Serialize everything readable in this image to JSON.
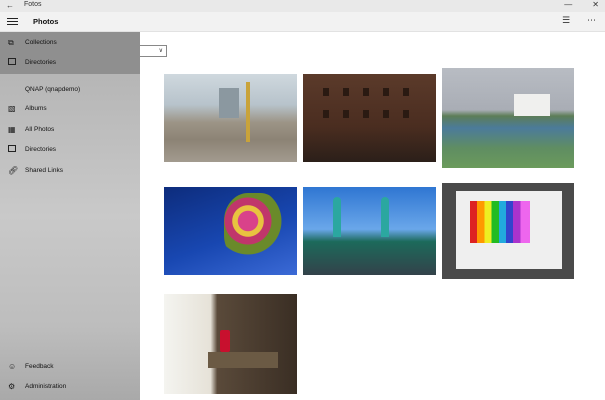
{
  "window": {
    "app_title": "Fotos",
    "back_glyph": "←",
    "minimize_glyph": "—",
    "close_glyph": "✕"
  },
  "header": {
    "title": "Photos",
    "menu_icon": "hamburger-icon",
    "select_icon": "select-list-icon",
    "more_icon": "more-icon"
  },
  "content": {
    "dropdown_glyph": "∨"
  },
  "sidebar": {
    "top_items": [
      {
        "label": "Collections",
        "icon": "collections-icon"
      },
      {
        "label": "Directories",
        "icon": "directories-icon"
      }
    ],
    "section_header": "QNAP (qnapdemo)",
    "section_items": [
      {
        "label": "Albums",
        "icon": "albums-icon"
      },
      {
        "label": "All Photos",
        "icon": "all-photos-icon"
      },
      {
        "label": "Directories",
        "icon": "directories-icon"
      },
      {
        "label": "Shared Links",
        "icon": "shared-links-icon"
      }
    ],
    "bottom_items": [
      {
        "label": "Feedback",
        "icon": "feedback-icon"
      },
      {
        "label": "Administration",
        "icon": "gear-icon"
      }
    ]
  },
  "colors": {
    "sidebar_overlay": "#bdbdbd",
    "header_bg": "#f2f2f2"
  }
}
